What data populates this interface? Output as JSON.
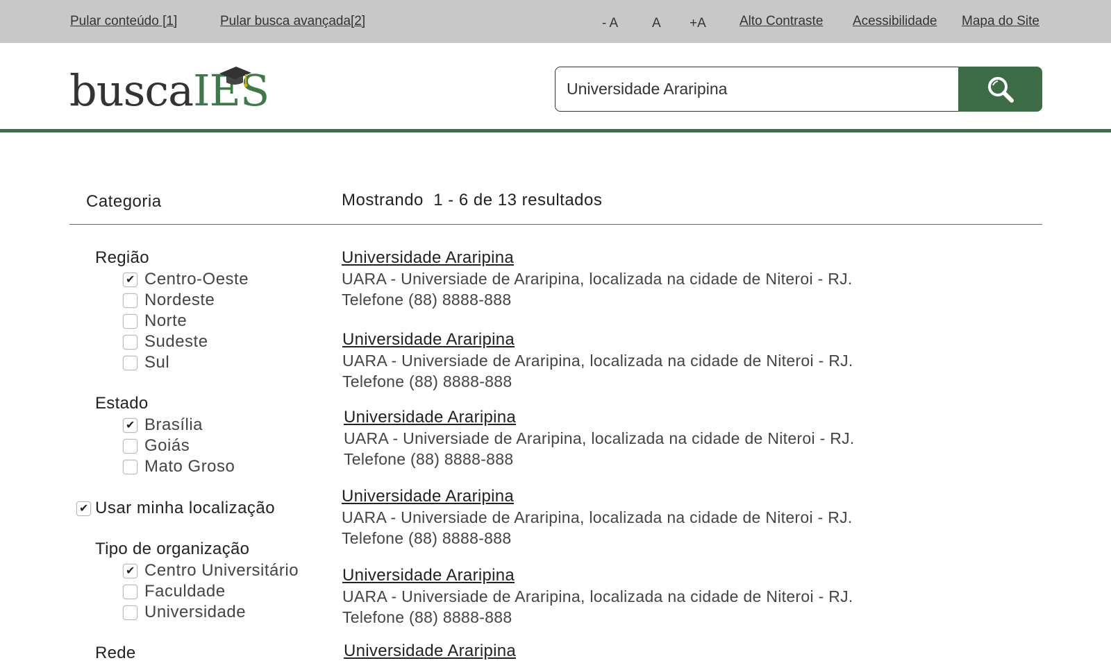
{
  "topbar": {
    "skip_content": "Pular conteúdo [1]",
    "skip_search": "Pular busca avançada[2]",
    "font_decrease": "- A",
    "font_normal": "A",
    "font_increase": "+A",
    "high_contrast": "Alto Contraste",
    "accessibility": "Acessibilidade",
    "sitemap": "Mapa do Site"
  },
  "header": {
    "logo_part1": "busca",
    "logo_part2": "IES",
    "search_value": "Universidade Araripina",
    "icons": {
      "search": "search-icon",
      "logo_cap": "graduation-cap-icon"
    }
  },
  "colors": {
    "brand_green": "#3d6d47",
    "topbar_gray": "#c8c8c8"
  },
  "sidebar": {
    "title": "Categoria",
    "regiao": {
      "title": "Região",
      "options": [
        {
          "label": "Centro-Oeste",
          "checked": true
        },
        {
          "label": "Nordeste",
          "checked": false
        },
        {
          "label": "Norte",
          "checked": false
        },
        {
          "label": "Sudeste",
          "checked": false
        },
        {
          "label": "Sul",
          "checked": false
        }
      ]
    },
    "estado": {
      "title": "Estado",
      "options": [
        {
          "label": "Brasília",
          "checked": true
        },
        {
          "label": "Goiás",
          "checked": false
        },
        {
          "label": "Mato Groso",
          "checked": false
        }
      ]
    },
    "localizacao": {
      "label": "Usar minha localização",
      "checked": true
    },
    "tipo": {
      "title": "Tipo de organização",
      "options": [
        {
          "label": "Centro Universitário",
          "checked": true
        },
        {
          "label": "Faculdade",
          "checked": false
        },
        {
          "label": "Universidade",
          "checked": false
        }
      ]
    },
    "rede": {
      "title": "Rede"
    }
  },
  "results": {
    "summary": "Mostrando  1 - 6 de 13 resultados",
    "items": [
      {
        "title": "Universidade Araripina",
        "desc": "UARA - Universiade de Araripina, localizada na cidade de Niteroi - RJ.",
        "phone": "Telefone (88) 8888-888"
      },
      {
        "title": "Universidade Araripina",
        "desc": "UARA - Universiade de Araripina, localizada na cidade de Niteroi - RJ.",
        "phone": "Telefone (88) 8888-888"
      },
      {
        "title": "Universidade Araripina",
        "desc": "UARA - Universiade de Araripina, localizada na cidade de Niteroi - RJ.",
        "phone": "Telefone (88) 8888-888"
      },
      {
        "title": "Universidade Araripina",
        "desc": "UARA - Universiade de Araripina, localizada na cidade de Niteroi - RJ.",
        "phone": "Telefone (88) 8888-888"
      },
      {
        "title": "Universidade Araripina",
        "desc": "UARA - Universiade de Araripina, localizada na cidade de Niteroi - RJ.",
        "phone": "Telefone (88) 8888-888"
      },
      {
        "title": "Universidade Araripina",
        "desc": "",
        "phone": ""
      }
    ]
  }
}
